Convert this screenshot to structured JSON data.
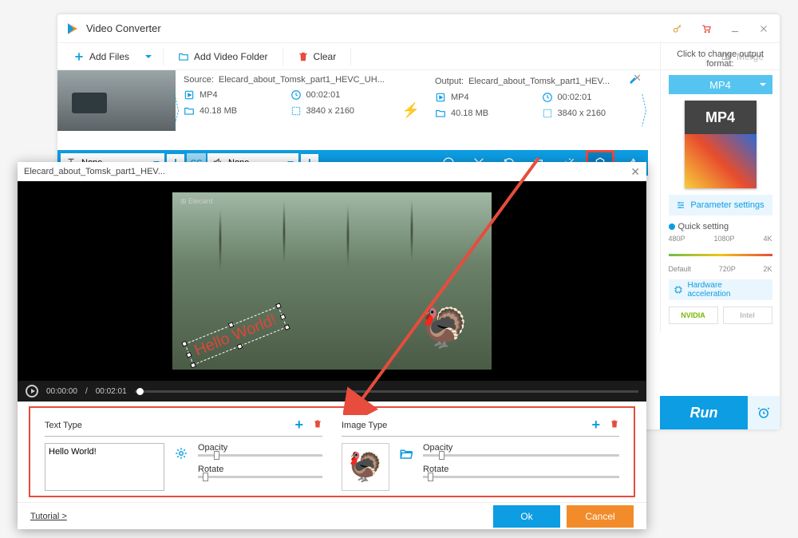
{
  "app": {
    "title": "Video Converter"
  },
  "toolbar": {
    "addFiles": "Add Files",
    "addFolder": "Add Video Folder",
    "clear": "Clear",
    "merge": "Merge"
  },
  "source": {
    "label": "Source:",
    "filename": "Elecard_about_Tomsk_part1_HEVC_UH...",
    "format": "MP4",
    "duration": "00:02:01",
    "size": "40.18 MB",
    "resolution": "3840 x 2160"
  },
  "output": {
    "label": "Output:",
    "filename": "Elecard_about_Tomsk_part1_HEV...",
    "format": "MP4",
    "duration": "00:02:01",
    "size": "40.18 MB",
    "resolution": "3840 x 2160"
  },
  "actionBar": {
    "subtitleText": "None",
    "audioText": "None"
  },
  "rightPanel": {
    "changeFormat": "Click to change output format:",
    "format": "MP4",
    "formatBig": "MP4",
    "parameter": "Parameter settings",
    "quickSetting": "Quick setting",
    "qsTop": [
      "480P",
      "1080P",
      "4K"
    ],
    "qsBot": [
      "Default",
      "720P",
      "2K"
    ],
    "hardware": "Hardware acceleration",
    "nvidia": "NVIDIA",
    "intel": "Intel",
    "run": "Run"
  },
  "modal": {
    "title": "Elecard_about_Tomsk_part1_HEV...",
    "timeCurrent": "00:00:00",
    "timeTotal": "00:02:01",
    "watermarkText": "Hello World!",
    "textType": "Text Type",
    "imageType": "Image Type",
    "textValue": "Hello World!",
    "opacity": "Opacity",
    "rotate": "Rotate",
    "tutorial": "Tutorial >",
    "ok": "Ok",
    "cancel": "Cancel"
  }
}
